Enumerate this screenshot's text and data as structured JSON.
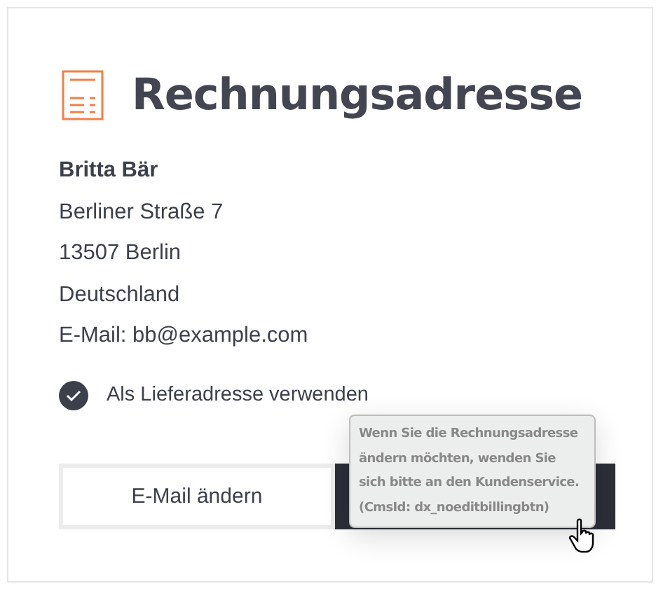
{
  "card": {
    "title": "Rechnungsadresse",
    "address": {
      "name": "Britta Bär",
      "lines": [
        "Berliner Straße 7",
        "13507 Berlin",
        "Deutschland",
        "E-Mail: bb@example.com"
      ]
    },
    "use_as_delivery": {
      "label": "Als Lieferadresse verwenden",
      "checked": true
    },
    "buttons": [
      {
        "kind": "outline",
        "label": "E-Mail ändern"
      },
      {
        "kind": "dark"
      }
    ],
    "tooltip": {
      "lines": [
        "Wenn Sie die Rechnungsadresse",
        "ändern möchten, wenden Sie",
        "sich bitte an den Kundenservice.",
        "(CmsId: dx_noeditbillingbtn)"
      ]
    }
  }
}
